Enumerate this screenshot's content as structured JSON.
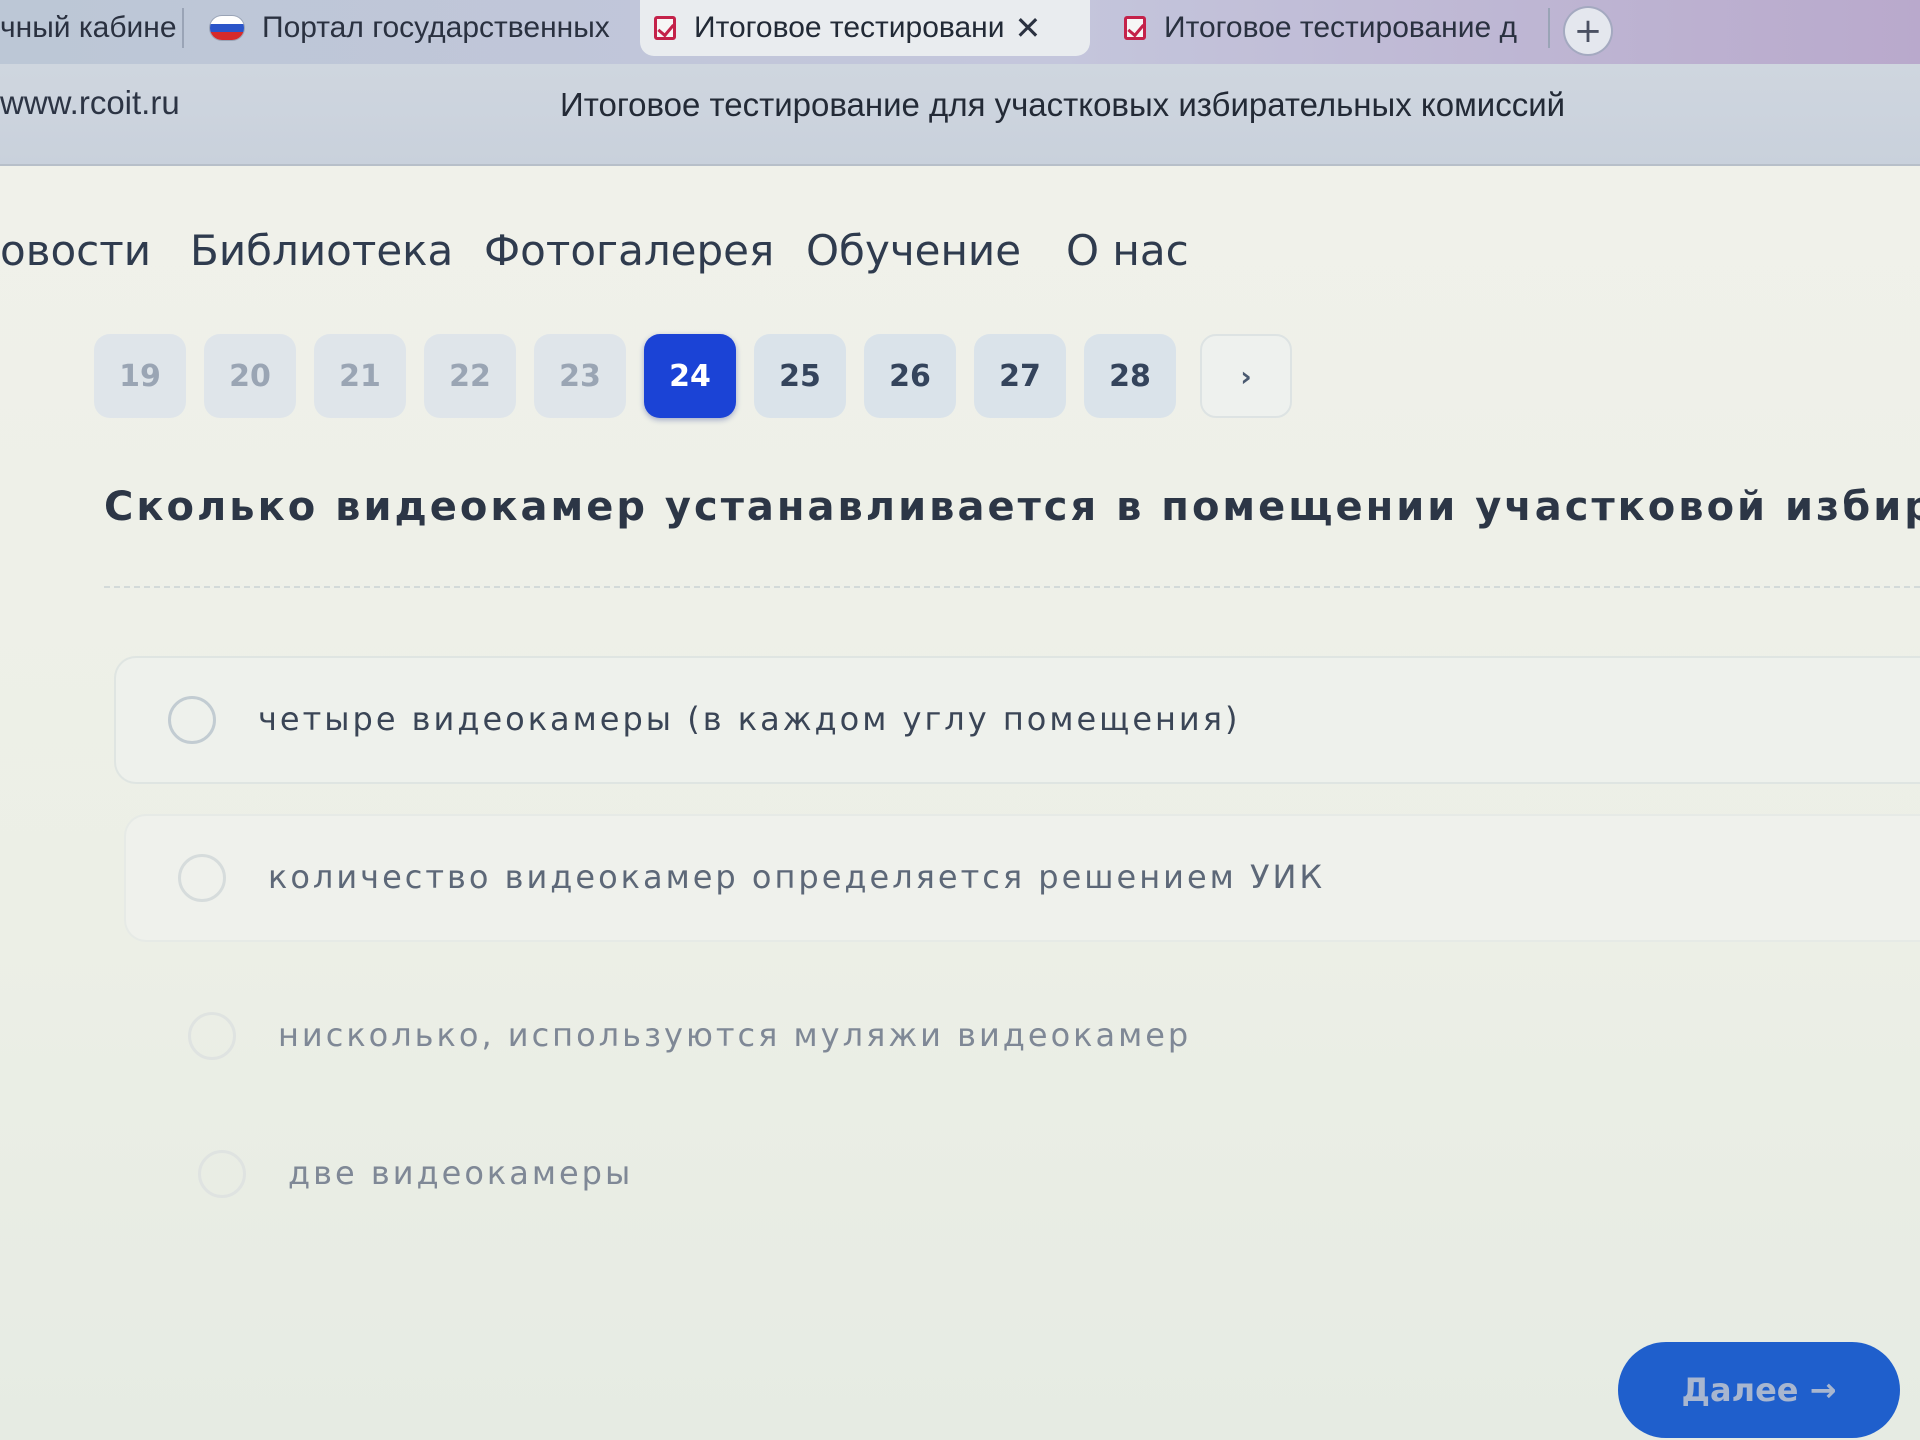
{
  "browser": {
    "tabs": [
      {
        "label": "чный кабине",
        "icon": "none"
      },
      {
        "label": "Портал государственных",
        "icon": "flag-icon"
      },
      {
        "label": "Итоговое тестировани",
        "icon": "test-icon",
        "active": true,
        "close": "✕"
      },
      {
        "label": "Итоговое тестирование д",
        "icon": "test-icon"
      }
    ],
    "new_tab_label": "+",
    "url": "www.rcoit.ru",
    "page_title": "Итоговое тестирование для участковых избирательных комиссий"
  },
  "nav": {
    "items": [
      "овости",
      "Библиотека",
      "Фотогалерея",
      "Обучение",
      "О нас"
    ]
  },
  "pagination": {
    "pages": [
      "19",
      "20",
      "21",
      "22",
      "23",
      "24",
      "25",
      "26",
      "27",
      "28"
    ],
    "current": "24",
    "next_label": "›"
  },
  "question": {
    "text": "Сколько видеокамер устанавливается в помещении участковой избирател",
    "options": [
      "четыре видеокамеры (в каждом углу помещения)",
      "количество видеокамер определяется решением УИК",
      "нисколько, используются муляжи видеокамер",
      "две видеокамеры"
    ]
  },
  "actions": {
    "next_label": "Далее →"
  },
  "colors": {
    "accent": "#1b43d6",
    "button": "#1f5fcc",
    "tab_icon": "#c4224a"
  }
}
